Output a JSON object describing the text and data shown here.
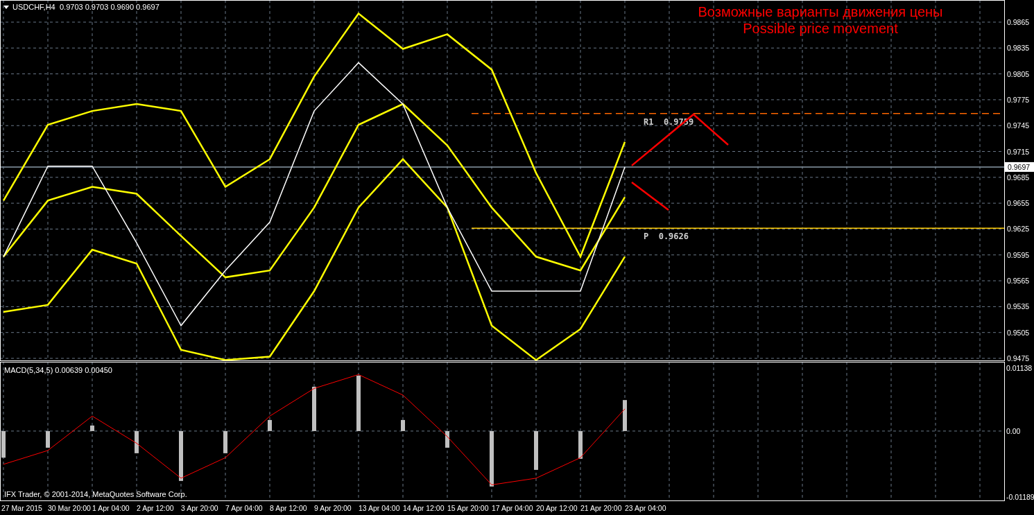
{
  "header": {
    "symbol": "USDCHF,H4",
    "quotes": "0.9703 0.9703 0.9690 0.9697"
  },
  "title": [
    "Возможные варианты движения цены",
    "Possible price movement"
  ],
  "price_chart": {
    "chart_data": {
      "type": "line",
      "grid": true,
      "categories": [
        null,
        null,
        null,
        null,
        null,
        null,
        null,
        null,
        null,
        null,
        null,
        null,
        null,
        null,
        null
      ],
      "ylim": [
        0.94726,
        0.98907
      ],
      "yticks": [
        0.9475,
        0.9505,
        0.9535,
        0.9565,
        0.9595,
        0.9625,
        0.9655,
        0.9685,
        0.9715,
        0.9745,
        0.9775,
        0.9805,
        0.9835,
        0.9865
      ],
      "series": [
        {
          "color": "#ffffff",
          "values": [
            0.9593,
            0.9698,
            0.9698,
            0.9609,
            0.9513,
            0.9577,
            0.9633,
            0.9762,
            0.9818,
            0.977,
            0.965,
            0.9553,
            0.9553,
            0.9553,
            0.9697
          ]
        },
        {
          "color": "#ffff00",
          "values": [
            0.9658,
            0.9746,
            0.9762,
            0.977,
            0.9762,
            0.9674,
            0.9706,
            0.9802,
            0.9875,
            0.9834,
            0.9851,
            0.981,
            0.969,
            0.9593,
            0.9726
          ]
        },
        {
          "color": "#ffff00",
          "values": [
            0.9593,
            0.9658,
            0.9674,
            0.9666,
            0.9617,
            0.9569,
            0.9577,
            0.965,
            0.9746,
            0.977,
            0.9722,
            0.965,
            0.9593,
            0.9577,
            0.9662
          ]
        },
        {
          "color": "#ffff00",
          "values": [
            0.9529,
            0.9537,
            0.9601,
            0.9585,
            0.9485,
            0.9473,
            0.9477,
            0.9553,
            0.965,
            0.9706,
            0.965,
            0.9513,
            0.9473,
            0.9509,
            0.9593
          ]
        }
      ],
      "ref_lines": [
        {
          "axis": "y",
          "value": 0.9759,
          "label": "R1  0.9759",
          "color": "#ff6600"
        },
        {
          "axis": "y",
          "value": 0.9626,
          "label": "P  0.9626",
          "color": "#ffcc00"
        },
        {
          "axis": "y",
          "value": 0.9697,
          "label": "0.9697",
          "color": "#8a9aa8"
        }
      ]
    }
  },
  "macd": {
    "label": "MACD(5,34,5) 0.00639 0.00450",
    "chart_data": {
      "type": "bar",
      "grid": true,
      "categories": [
        "27 Mar 2015",
        "30 Mar 20:00",
        "1 Apr 04:00",
        "2 Apr 12:00",
        "3 Apr 20:00",
        "7 Apr 04:00",
        "8 Apr 12:00",
        "9 Apr 20:00",
        "13 Apr 04:00",
        "14 Apr 12:00",
        "15 Apr 20:00",
        "17 Apr 04:00",
        "20 Apr 12:00",
        "21 Apr 20:00",
        "23 Apr 04:00"
      ],
      "ylim": [
        -0.01252,
        0.0125
      ],
      "yticks": [
        {
          "value": 0.01138,
          "label": "0.01138"
        },
        {
          "value": 0,
          "label": "0.00"
        },
        {
          "value": -0.01189,
          "label": "-0.01189"
        }
      ],
      "series": [
        {
          "type": "bar",
          "color": "#c0c0c0",
          "values": [
            -0.0048,
            -0.003,
            0.001,
            -0.004,
            -0.009,
            -0.004,
            0.002,
            0.008,
            0.01,
            0.002,
            -0.003,
            -0.01,
            -0.007,
            -0.005,
            0.0056
          ]
        },
        {
          "type": "line",
          "color": "#ff0000",
          "values": [
            -0.006,
            -0.0035,
            0.0027,
            -0.0022,
            -0.0085,
            -0.0048,
            0.0027,
            0.0077,
            0.0102,
            0.0065,
            -0.001,
            -0.0097,
            -0.0085,
            -0.0048,
            0.004
          ]
        }
      ]
    }
  },
  "copyright": "IFX Trader, © 2001-2014, MetaQuotes Software Corp."
}
